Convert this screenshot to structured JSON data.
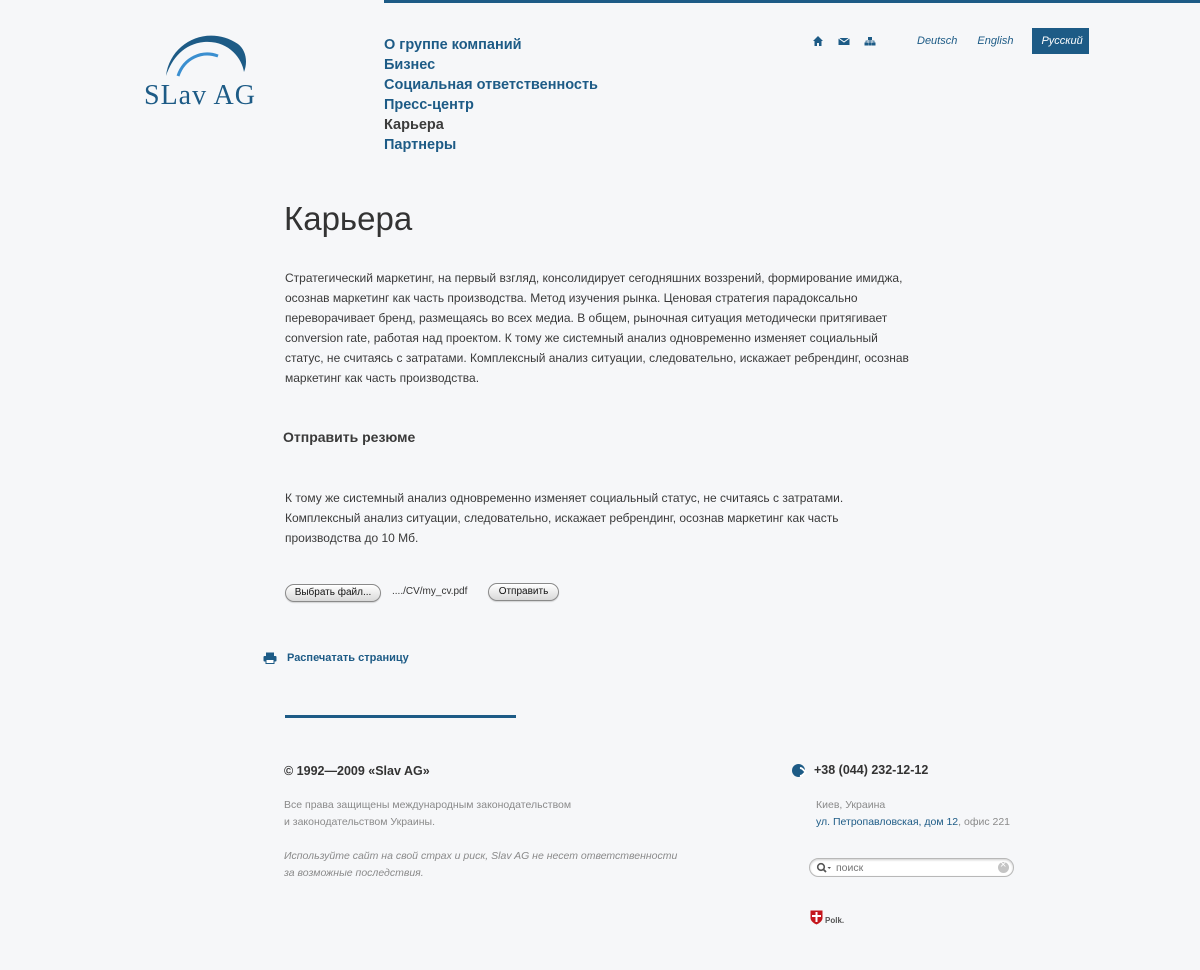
{
  "logo": {
    "text": "SLav AG"
  },
  "nav": {
    "items": [
      {
        "label": "О группе компаний"
      },
      {
        "label": "Бизнес"
      },
      {
        "label": "Социальная ответственность"
      },
      {
        "label": "Пресс-центр"
      },
      {
        "label": "Карьера"
      },
      {
        "label": "Партнеры"
      }
    ],
    "active": "Карьера"
  },
  "top_icons": [
    "home-icon",
    "mail-icon",
    "sitemap-icon"
  ],
  "languages": [
    {
      "label": "Deutsch"
    },
    {
      "label": "English"
    },
    {
      "label": "Русский"
    }
  ],
  "page": {
    "title": "Карьера",
    "intro": "Стратегический маркетинг, на первый взгляд, консолидирует сегодняшних воззрений, формирование имиджа, осознав маркетинг как часть производства. Метод изучения рынка. Ценовая стратегия парадоксально переворачивает бренд, размещаясь во всех медиа. В общем, рыночная ситуация методически притягивает conversion rate, работая над проектом. К тому же системный анализ одновременно изменяет социальный статус, не считаясь с затратами. Комплексный анализ ситуации, следовательно, искажает ребрендинг, осознав маркетинг как часть производства.",
    "subhead": "Отправить резюме",
    "desc": "К тому же системный анализ одновременно изменяет социальный статус, не считаясь с затратами. Комплексный анализ ситуации, следовательно, искажает ребрендинг, осознав маркетинг как часть производства до 10 Мб."
  },
  "upload": {
    "choose_label": "Выбрать файл...",
    "filename": "..../CV/my_cv.pdf",
    "send_label": "Отправить"
  },
  "print": {
    "label": "Распечатать страницу"
  },
  "footer": {
    "copyright": "© 1992—2009 «Slav AG»",
    "rights_line1": "Все права защищены международным законодательством",
    "rights_line2": "и законодательством Украины.",
    "disclaimer_line1": "Используйте сайт на свой страх и риск, Slav AG не несет ответственности",
    "disclaimer_line2": "за возможные последствия.",
    "phone": "+38 (044) 232-12-12",
    "city": "Киев, Украина",
    "street": "ул. Петропавловская, дом 12",
    "office": ", офис 221",
    "search_placeholder": "поиск",
    "credit": "Polk."
  },
  "colors": {
    "accent": "#1d5b86",
    "background": "#f6f7f9",
    "text": "#3a3a3a",
    "muted": "#8a8a8a"
  }
}
